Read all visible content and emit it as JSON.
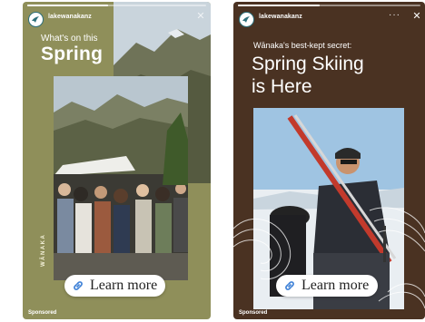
{
  "stories": [
    {
      "account": {
        "handle": "lakewanakanz"
      },
      "progress_fraction": 0.45,
      "headline": {
        "eyebrow": "What's on this",
        "title": "Spring"
      },
      "side_brand": "WĀNAKA",
      "cta": {
        "label": "Learn more",
        "icon": "link-icon"
      },
      "footer": {
        "sponsored": "Sponsored"
      },
      "close_icon": "close-icon",
      "accent_color": "#8f8f5a"
    },
    {
      "account": {
        "handle": "lakewanakanz"
      },
      "progress_fraction": 0.45,
      "headline": {
        "eyebrow": "Wānaka's best-kept secret:",
        "title_line_1": "Spring Skiing",
        "title_line_2": "is Here"
      },
      "cta": {
        "label": "Learn more",
        "icon": "link-icon"
      },
      "footer": {
        "sponsored": "Sponsored"
      },
      "more_icon": "more-icon",
      "close_icon": "close-icon",
      "accent_color": "#4a3222"
    }
  ]
}
